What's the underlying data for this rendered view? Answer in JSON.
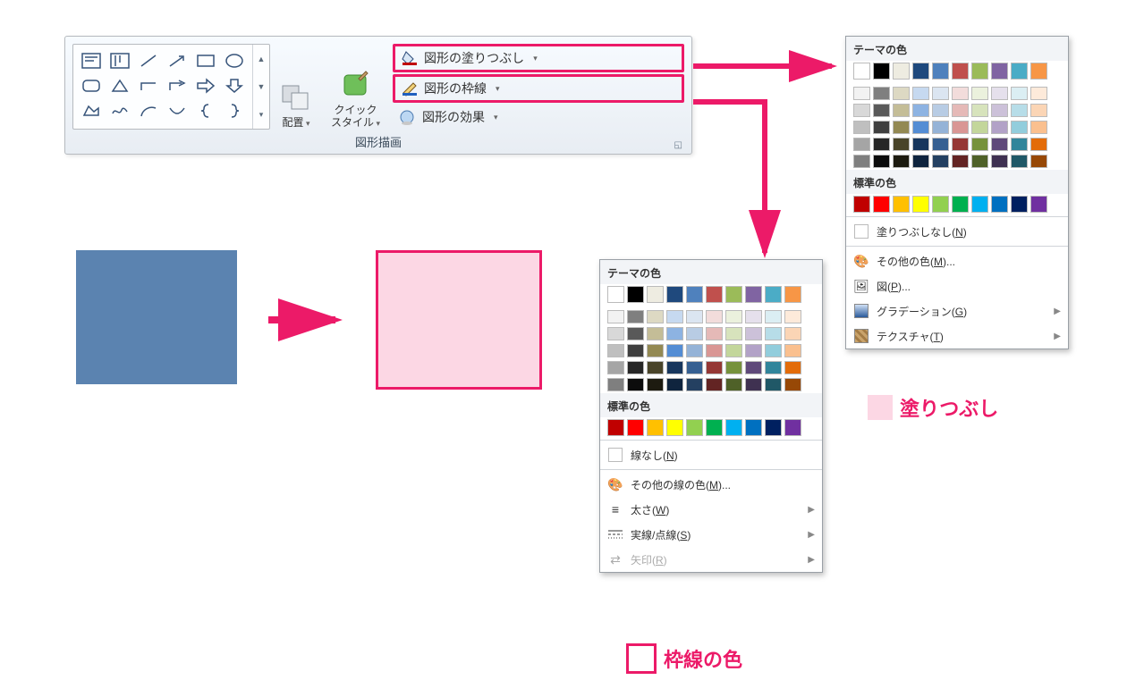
{
  "ribbon": {
    "caption": "図形描画",
    "arrange_label": "配置",
    "quickstyle_label": "クイック\nスタイル",
    "shape_fill_label": "図形の塗りつぶし",
    "shape_outline_label": "図形の枠線",
    "shape_effects_label": "図形の効果"
  },
  "theme_colors_hdr": "テーマの色",
  "standard_colors_hdr": "標準の色",
  "theme_row": [
    "#ffffff",
    "#000000",
    "#eeece1",
    "#1f497d",
    "#4f81bd",
    "#c0504d",
    "#9bbb59",
    "#8064a2",
    "#4bacc6",
    "#f79646"
  ],
  "theme_tints": [
    [
      "#f2f2f2",
      "#7f7f7f",
      "#ddd9c3",
      "#c6d9f0",
      "#dbe5f1",
      "#f2dcdb",
      "#ebf1dd",
      "#e5e0ec",
      "#dbeef3",
      "#fdeada"
    ],
    [
      "#d8d8d8",
      "#595959",
      "#c4bd97",
      "#8db3e2",
      "#b8cce4",
      "#e5b9b7",
      "#d7e3bc",
      "#ccc1d9",
      "#b7dde8",
      "#fbd5b5"
    ],
    [
      "#bfbfbf",
      "#3f3f3f",
      "#938953",
      "#548dd4",
      "#95b3d7",
      "#d99694",
      "#c3d69b",
      "#b2a2c7",
      "#92cddc",
      "#fac08f"
    ],
    [
      "#a5a5a5",
      "#262626",
      "#494429",
      "#17365d",
      "#366092",
      "#953734",
      "#76923c",
      "#5f497a",
      "#31859b",
      "#e36c09"
    ],
    [
      "#7f7f7f",
      "#0c0c0c",
      "#1d1b10",
      "#0f243e",
      "#244061",
      "#632423",
      "#4f6128",
      "#3f3151",
      "#205867",
      "#974806"
    ]
  ],
  "standard_row": [
    "#c00000",
    "#ff0000",
    "#ffc000",
    "#ffff00",
    "#92d050",
    "#00b050",
    "#00b0f0",
    "#0070c0",
    "#002060",
    "#7030a0"
  ],
  "fill_panel": {
    "no_fill": "塗りつぶしなし(",
    "no_fill_u": "N",
    "more_colors": "その他の色(",
    "more_colors_u": "M",
    "picture": "図(",
    "picture_u": "P",
    "gradient": "グラデーション(",
    "gradient_u": "G",
    "texture": "テクスチャ(",
    "texture_u": "T"
  },
  "outline_panel": {
    "no_line": "線なし(",
    "no_line_u": "N",
    "more_colors": "その他の線の色(",
    "more_colors_u": "M",
    "weight": "太さ(",
    "weight_u": "W",
    "dash": "実線/点線(",
    "dash_u": "S",
    "arrows": "矢印(",
    "arrows_u": "R"
  },
  "annot": {
    "fill": "塗りつぶし",
    "outline": "枠線の色"
  },
  "sample": {
    "before_fill": "#5b83b0",
    "after_fill": "#fcd7e4",
    "after_border": "#ec1a68",
    "annot_fill_swatch": "#fcd7e4",
    "annot_outline_swatch_border": "#ec1a68"
  }
}
